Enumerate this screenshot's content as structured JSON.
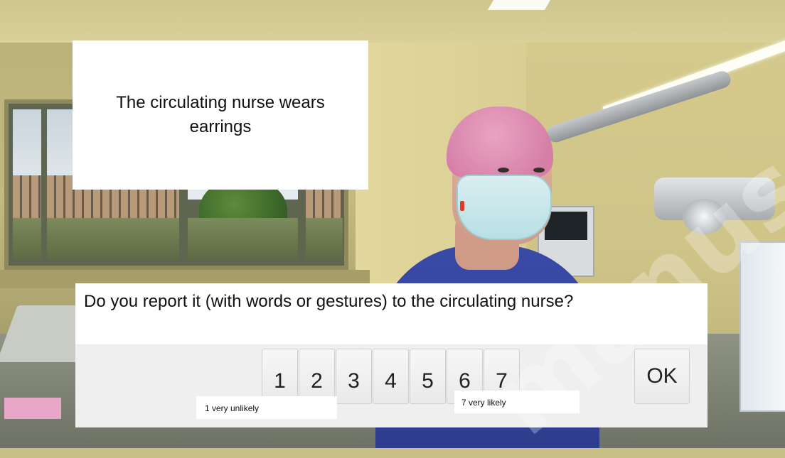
{
  "statement": {
    "text": "The circulating nurse wears earrings"
  },
  "question": {
    "text": "Do you report it (with words or gestures) to the circulating nurse?"
  },
  "scale": {
    "options": [
      "1",
      "2",
      "3",
      "4",
      "5",
      "6",
      "7"
    ],
    "low_label": "1 very unlikely",
    "high_label": "7 very likely"
  },
  "ok_button": {
    "label": "OK"
  },
  "watermark": {
    "text": "manus"
  },
  "colors": {
    "panel": "#ffffff",
    "answer_bar": "#efefef",
    "scrub_color": "#3a4aa8",
    "cap_color": "#e9a3c2",
    "mask_color": "#d9eef1",
    "earring_color": "#e23a2a"
  },
  "icons": [
    "nurse-avatar",
    "operating-room-background",
    "surgical-microscope"
  ]
}
